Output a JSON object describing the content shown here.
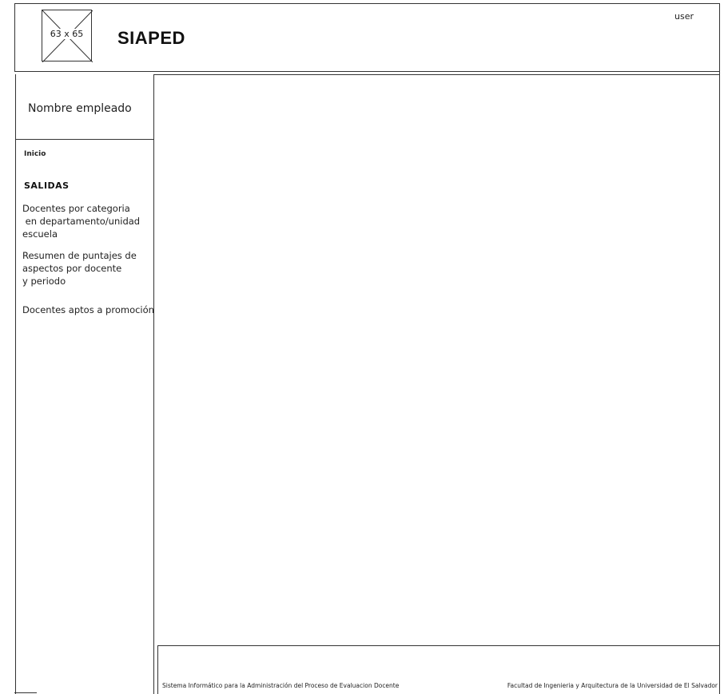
{
  "header": {
    "logo_placeholder": "63 x 65",
    "title": "SIAPED",
    "user_label": "user"
  },
  "sidebar": {
    "profile_name": "Nombre empleado",
    "inicio_label": "Inicio",
    "section_title": "SALIDAS",
    "items": [
      {
        "label": "Docentes por categoria\n en departamento/unidad\nescuela"
      },
      {
        "label": "Resumen de puntajes de\naspectos por docente\ny periodo"
      },
      {
        "label": "Docentes aptos a promoción"
      }
    ]
  },
  "footer": {
    "left_text": "Sistema Informático para la Administración del Proceso de Evaluacion Docente",
    "right_text": "Facultad de Ingenieria y Arquitectura de la Universidad de El Salvador"
  }
}
